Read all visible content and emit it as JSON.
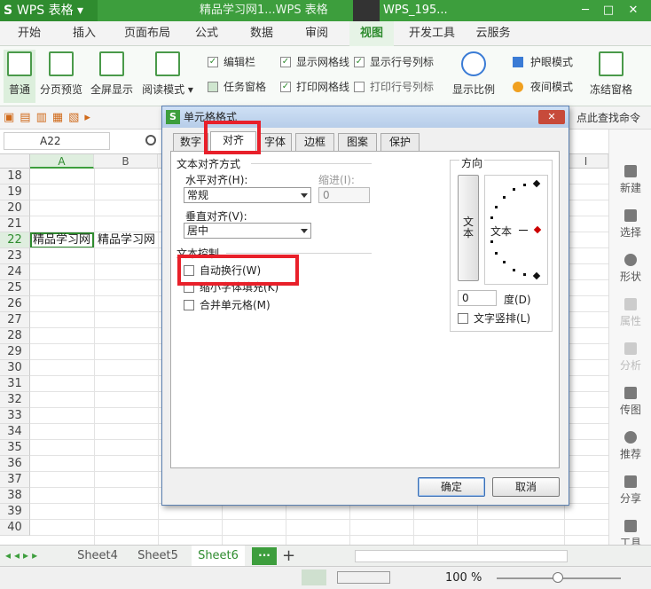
{
  "app": {
    "name": "WPS 表格",
    "doc_title": "精品学习网1...WPS 表格",
    "user": "WPS_195..."
  },
  "menu": [
    "开始",
    "插入",
    "页面布局",
    "公式",
    "数据",
    "审阅",
    "视图",
    "开发工具",
    "云服务"
  ],
  "active_menu": "视图",
  "ribbon": {
    "buttons": [
      "普通",
      "分页预览",
      "全屏显示",
      "阅读模式"
    ],
    "checks": [
      {
        "label": "编辑栏",
        "checked": true
      },
      {
        "label": "任务窗格",
        "checked": false
      },
      {
        "label": "显示网格线",
        "checked": true
      },
      {
        "label": "打印网格线",
        "checked": true
      },
      {
        "label": "显示行号列标",
        "checked": true
      },
      {
        "label": "打印行号列标",
        "checked": false
      }
    ],
    "zoom_label": "显示比例",
    "eye_mode": "护眼模式",
    "night_mode": "夜间模式",
    "freeze": "冻结窗格"
  },
  "quickbar_hint": "点此查找命令",
  "namebox": "A22",
  "columns": [
    "A",
    "B",
    "I"
  ],
  "rows": [
    "18",
    "19",
    "20",
    "21",
    "22",
    "23",
    "24",
    "25",
    "26",
    "27",
    "28",
    "29",
    "30",
    "31",
    "32",
    "33",
    "34",
    "35",
    "36",
    "37",
    "38",
    "39",
    "40"
  ],
  "cell_a22": "精品学习网",
  "cell_b22": "精品学习网",
  "sidebar": [
    "新建",
    "选择",
    "形状",
    "属性",
    "分析",
    "传图",
    "推荐",
    "分享",
    "工具"
  ],
  "sheets": [
    "Sheet4",
    "Sheet5",
    "Sheet6"
  ],
  "active_sheet": "Sheet6",
  "zoom_value": "100 %",
  "dialog": {
    "title": "单元格格式",
    "tabs": [
      "数字",
      "对齐",
      "字体",
      "边框",
      "图案",
      "保护"
    ],
    "active_tab": "对齐",
    "text_align_group": "文本对齐方式",
    "horizontal_label": "水平对齐(H):",
    "horizontal_value": "常规",
    "indent_label": "缩进(I):",
    "indent_value": "0",
    "vertical_label": "垂直对齐(V):",
    "vertical_value": "居中",
    "text_control_group": "文本控制",
    "wrap_label": "自动换行(W)",
    "shrink_label": "缩小字体填充(K)",
    "merge_label": "合并单元格(M)",
    "orientation_group": "方向",
    "vertical_text": "文本",
    "dial_text": "文本",
    "degree_value": "0",
    "degree_label": "度(D)",
    "vertical_text_check": "文字竖排(L)",
    "ok": "确定",
    "cancel": "取消"
  },
  "colors": {
    "brand": "#3d9e3d",
    "highlight": "#e8202a"
  }
}
